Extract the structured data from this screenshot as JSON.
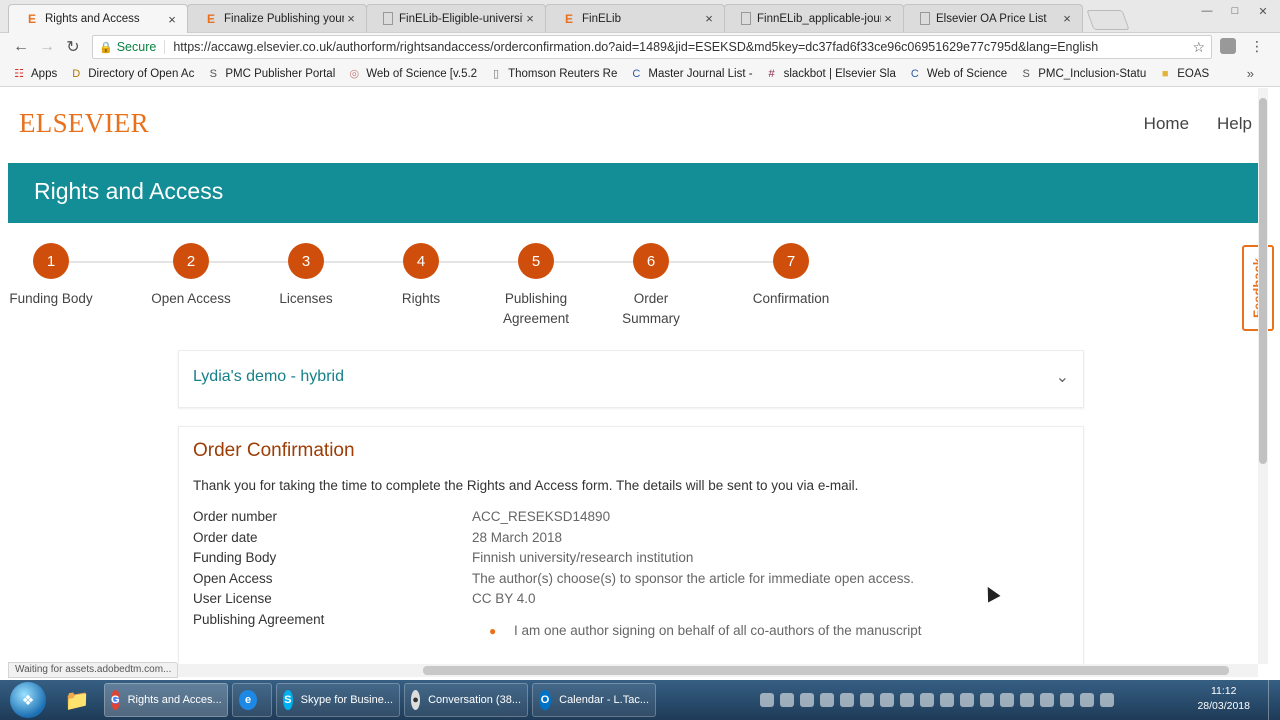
{
  "browser": {
    "tabs": [
      {
        "icon": "E",
        "title": "Rights and Access",
        "active": true
      },
      {
        "icon": "E",
        "title": "Finalize Publishing your /"
      },
      {
        "icon": "doc",
        "title": "FinELib-Eligible-universit"
      },
      {
        "icon": "E",
        "title": "FinELib"
      },
      {
        "icon": "doc",
        "title": "FinnELib_applicable-jour"
      },
      {
        "icon": "doc",
        "title": "Elsevier OA Price List"
      }
    ],
    "secure_label": "Secure",
    "url": "https://accawg.elsevier.co.uk/authorform/rightsandaccess/orderconfirmation.do?aid=1489&jid=ESEKSD&md5key=dc37fad6f33ce96c06951629e77c795d&lang=English",
    "bookmarks": [
      {
        "icon": "apps",
        "label": "Apps"
      },
      {
        "icon": "D",
        "label": "Directory of Open Ac"
      },
      {
        "icon": "S",
        "label": "PMC Publisher Portal"
      },
      {
        "icon": "globe",
        "label": "Web of Science [v.5.2"
      },
      {
        "icon": "doc",
        "label": "Thomson Reuters Re"
      },
      {
        "icon": "C",
        "label": "Master Journal List -"
      },
      {
        "icon": "slack",
        "label": "slackbot | Elsevier Sla"
      },
      {
        "icon": "C",
        "label": "Web of Science"
      },
      {
        "icon": "S",
        "label": "PMC_Inclusion-Statu"
      },
      {
        "icon": "folder",
        "label": "EOAS"
      }
    ],
    "status_text": "Waiting for assets.adobedtm.com..."
  },
  "site": {
    "logo": "ELSEVIER",
    "nav": {
      "home": "Home",
      "help": "Help"
    },
    "banner_title": "Rights and Access",
    "steps": [
      {
        "num": "1",
        "label": "Funding Body"
      },
      {
        "num": "2",
        "label": "Open Access"
      },
      {
        "num": "3",
        "label": "Licenses"
      },
      {
        "num": "4",
        "label": "Rights"
      },
      {
        "num": "5",
        "label": "Publishing Agreement"
      },
      {
        "num": "6",
        "label": "Order Summary"
      },
      {
        "num": "7",
        "label": "Confirmation"
      }
    ],
    "accordion_title": "Lydia's demo - hybrid",
    "feedback": "Feedback"
  },
  "order": {
    "heading": "Order Confirmation",
    "thanks": "Thank you for taking the time to complete the Rights and Access form. The details will be sent to you via e-mail.",
    "details": [
      {
        "label": "Order number",
        "value": "ACC_RESEKSD14890"
      },
      {
        "label": "Order date",
        "value": "28 March 2018"
      },
      {
        "label": "Funding Body",
        "value": "Finnish university/research institution"
      },
      {
        "label": "Open Access",
        "value": "The author(s) choose(s) to sponsor the article for immediate open access."
      },
      {
        "label": "User License",
        "value": "CC BY 4.0"
      },
      {
        "label": "Publishing Agreement",
        "value": ""
      }
    ],
    "agreement_bullet": "I am one author signing on behalf of all co-authors of the manuscript"
  },
  "taskbar": {
    "items": [
      {
        "icon": "chrome",
        "label": "Rights and Acces...",
        "active": true
      },
      {
        "icon": "ie",
        "label": ""
      },
      {
        "icon": "skype",
        "label": "Skype for Busine..."
      },
      {
        "icon": "chat",
        "label": "Conversation (38..."
      },
      {
        "icon": "outlook",
        "label": "Calendar - L.Tac..."
      }
    ],
    "time": "11:12",
    "date": "28/03/2018"
  },
  "colors": {
    "brand_orange": "#e9711c",
    "banner_teal": "#138d96",
    "step_red": "#d04e0b"
  }
}
